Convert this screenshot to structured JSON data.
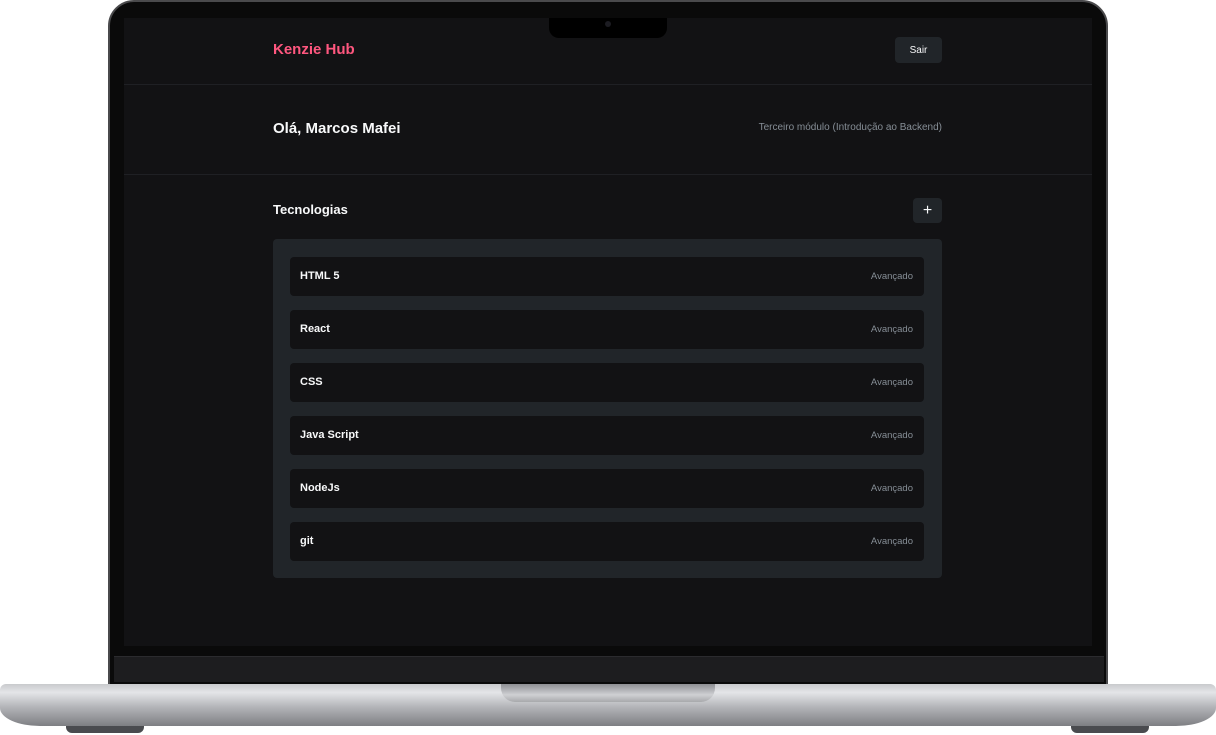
{
  "header": {
    "brand": "Kenzie Hub",
    "logout_label": "Sair"
  },
  "profile": {
    "greeting": "Olá, Marcos Mafei",
    "module": "Terceiro módulo (Introdução ao Backend)"
  },
  "technologies": {
    "title": "Tecnologias",
    "add_label": "+",
    "items": [
      {
        "name": "HTML 5",
        "level": "Avançado"
      },
      {
        "name": "React",
        "level": "Avançado"
      },
      {
        "name": "CSS",
        "level": "Avançado"
      },
      {
        "name": "Java Script",
        "level": "Avançado"
      },
      {
        "name": "NodeJs",
        "level": "Avançado"
      },
      {
        "name": "git",
        "level": "Avançado"
      }
    ]
  },
  "colors": {
    "brand": "#ff577f",
    "background": "#121214",
    "panel": "#212529",
    "muted_text": "#868e96"
  }
}
